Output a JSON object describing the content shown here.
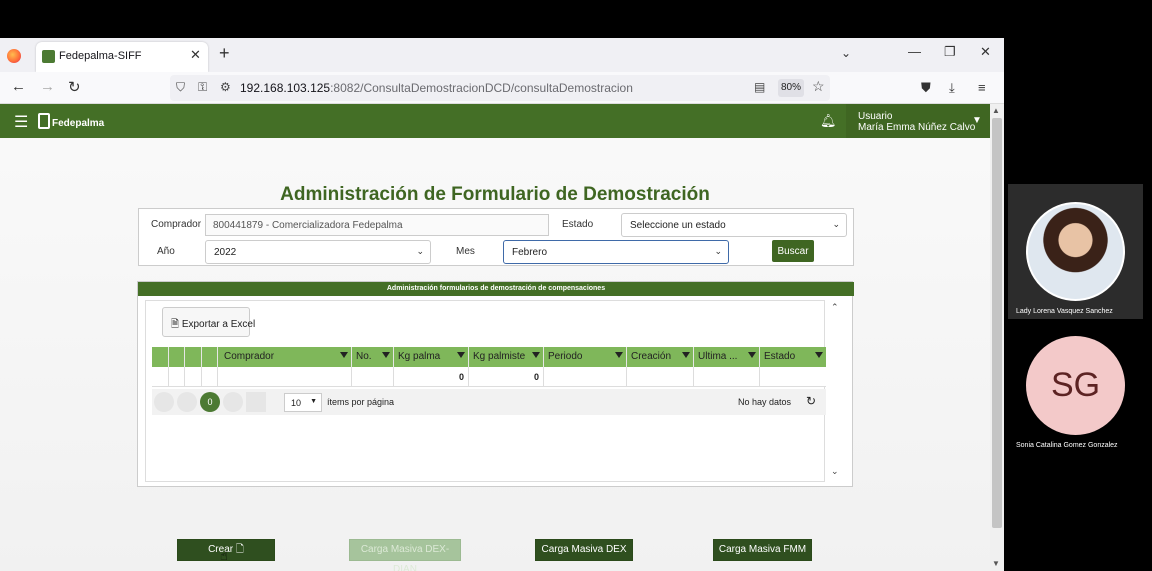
{
  "browser": {
    "tab_title": "Fedepalma-SIFF",
    "url_host": "192.168.103.125",
    "url_path": ":8082/ConsultaDemostracionDCD/consultaDemostracion",
    "zoom": "80%"
  },
  "app": {
    "logo_text": "Fedepalma",
    "user_label": "Usuario",
    "user_name": "María Emma Núñez Calvo"
  },
  "page": {
    "title": "Administración de Formulario de Demostración"
  },
  "filters": {
    "comprador_label": "Comprador",
    "comprador_value": "800441879 - Comercializadora Fedepalma",
    "estado_label": "Estado",
    "estado_value": "Seleccione un estado",
    "anio_label": "Año",
    "anio_value": "2022",
    "mes_label": "Mes",
    "mes_value": "Febrero",
    "buscar_label": "Buscar"
  },
  "grid": {
    "header": "Administración formularios de demostración de compensaciones",
    "export_label": "Exportar a Excel",
    "columns": [
      "Comprador",
      "No.",
      "Kg palma",
      "Kg palmiste",
      "Periodo",
      "Creación",
      "Ultima ...",
      "Estado"
    ],
    "totals": {
      "kg_palma": "0",
      "kg_palmiste": "0"
    },
    "pager": {
      "current_page": "0",
      "page_size": "10",
      "page_size_label": "ítems por página",
      "empty_text": "No hay datos"
    }
  },
  "actions": {
    "crear": "Crear",
    "carga_dex_dian": "Carga Masiva DEX-DIAN",
    "carga_dex": "Carga Masiva DEX",
    "carga_fmm": "Carga Masiva FMM"
  },
  "participants": [
    {
      "name": "Lady Lorena Vasquez Sanchez"
    },
    {
      "name": "Sonia Catalina Gomez Gonzalez",
      "initials": "SG"
    }
  ],
  "colors": {
    "brand_green": "#446f26",
    "grid_header_green": "#7fb75a",
    "dark_button": "#2f4f1f"
  }
}
